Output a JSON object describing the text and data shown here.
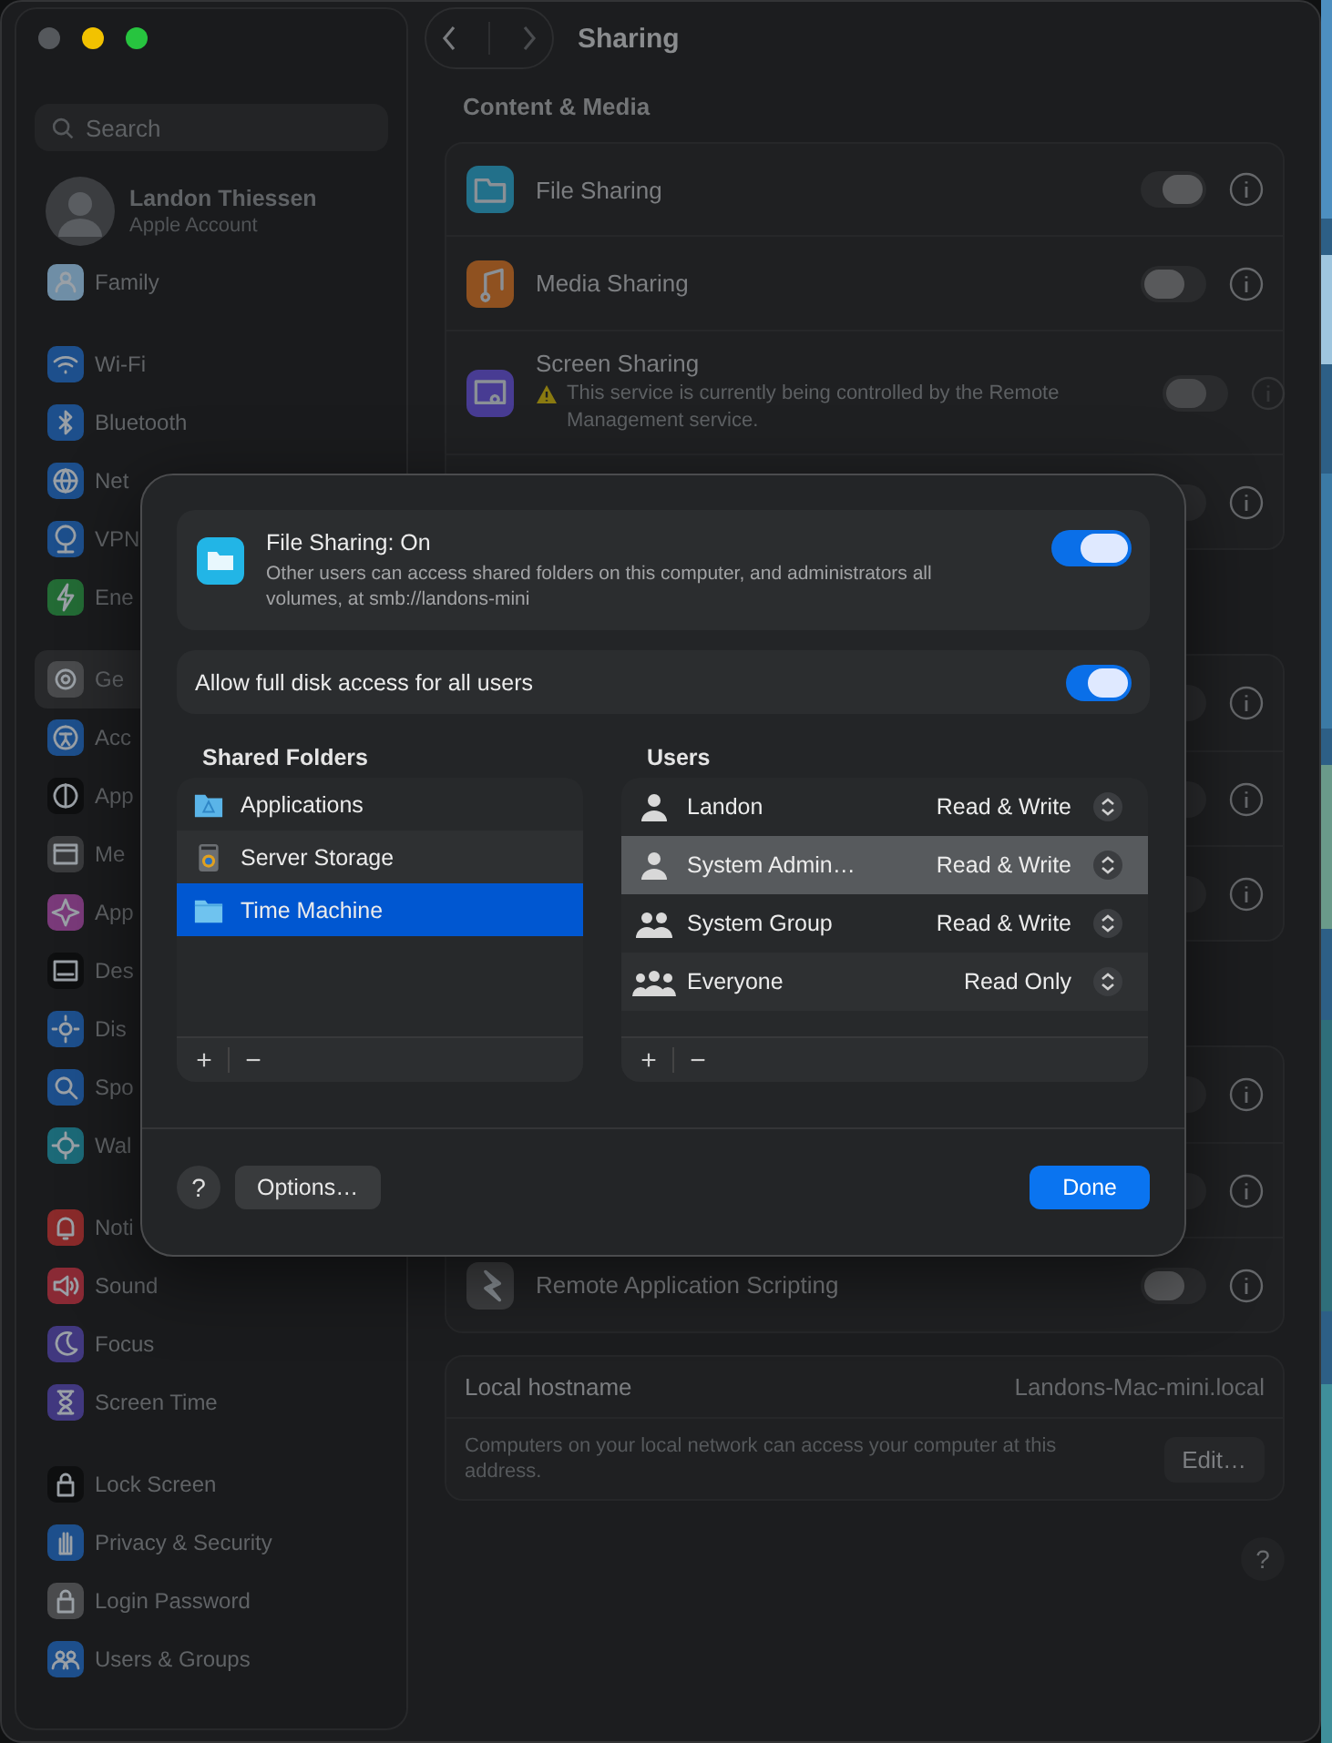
{
  "sidebar": {
    "search": {
      "placeholder": "Search"
    },
    "account": {
      "name": "Landon Thiessen",
      "subtitle": "Apple Account"
    },
    "groups": [
      [
        {
          "label": "Family",
          "kind": "family",
          "color": "#6f8ea6",
          "selected": false
        }
      ],
      [
        {
          "label": "Wi-Fi",
          "kind": "wifi",
          "color": "#1d4f8c",
          "selected": false
        },
        {
          "label": "Bluetooth",
          "kind": "bluetooth",
          "color": "#1d4f8c",
          "selected": false
        },
        {
          "label": "Net",
          "kind": "globe",
          "color": "#1d4f8c",
          "selected": false
        },
        {
          "label": "VPN",
          "kind": "globe-stand",
          "color": "#1d4f8c",
          "selected": false
        },
        {
          "label": "Ene",
          "kind": "bolt",
          "color": "#236b35",
          "selected": false
        }
      ],
      [
        {
          "label": "Ge",
          "kind": "gear",
          "color": "#4a4b4d",
          "selected": true
        },
        {
          "label": "Acc",
          "kind": "person-circle",
          "color": "#1d4f8c",
          "selected": false
        },
        {
          "label": "App",
          "kind": "half-circle",
          "color": "#0e0f10",
          "selected": false
        },
        {
          "label": "Me",
          "kind": "window",
          "color": "#3a3b3d",
          "selected": false
        },
        {
          "label": "App",
          "kind": "sparkle",
          "color": "#7a3a7a",
          "selected": false
        },
        {
          "label": "Des",
          "kind": "dock",
          "color": "#0e0f10",
          "selected": false
        },
        {
          "label": "Dis",
          "kind": "sun",
          "color": "#1d4f8c",
          "selected": false
        },
        {
          "label": "Spo",
          "kind": "magnifier",
          "color": "#1d4f8c",
          "selected": false
        },
        {
          "label": "Wal",
          "kind": "flower",
          "color": "#1c6a78",
          "selected": false
        }
      ],
      [
        {
          "label": "Noti",
          "kind": "bell",
          "color": "#8a2a2a",
          "selected": false
        },
        {
          "label": "Sound",
          "kind": "speaker",
          "color": "#8a2a35",
          "selected": false
        },
        {
          "label": "Focus",
          "kind": "moon",
          "color": "#41387f",
          "selected": false
        },
        {
          "label": "Screen Time",
          "kind": "hourglass",
          "color": "#41387f",
          "selected": false
        }
      ],
      [
        {
          "label": "Lock Screen",
          "kind": "lock",
          "color": "#0e0f10",
          "selected": false
        },
        {
          "label": "Privacy & Security",
          "kind": "hand",
          "color": "#1d4f8c",
          "selected": false
        },
        {
          "label": "Login Password",
          "kind": "lock",
          "color": "#4a4b4d",
          "selected": false
        },
        {
          "label": "Users & Groups",
          "kind": "people",
          "color": "#1d4f8c",
          "selected": false
        }
      ]
    ]
  },
  "header": {
    "title": "Sharing"
  },
  "sections": [
    {
      "title": "Content & Media",
      "rows": [
        {
          "label": "File Sharing",
          "kind": "folder",
          "color": "#22708a",
          "on": true,
          "disabled": false
        },
        {
          "label": "Media Sharing",
          "kind": "music",
          "color": "#8f5120",
          "on": false,
          "disabled": false
        },
        {
          "label": "Screen Sharing",
          "kind": "screen",
          "color": "#483c93",
          "on": false,
          "disabled": true,
          "warning": "This service is currently being controlled by the Remote Management service."
        },
        {
          "on": false,
          "disabled": false
        }
      ]
    },
    {
      "rows": [
        {
          "on": false,
          "disabled": false
        },
        {
          "on": false,
          "disabled": false
        },
        {
          "on": false,
          "disabled": false
        }
      ]
    },
    {
      "rows": [
        {
          "on": false,
          "disabled": false
        },
        {
          "on": false,
          "disabled": false
        },
        {
          "label": "Remote Application Scripting",
          "kind": "feather",
          "color": "#3e3f41",
          "on": false,
          "disabled": false
        }
      ]
    }
  ],
  "hostname": {
    "label": "Local hostname",
    "value": "Landons-Mac-mini.local",
    "note": "Computers on your local network can access your computer at this address.",
    "button": "Edit…"
  },
  "help": "?",
  "dialog": {
    "service": {
      "title": "File Sharing: On",
      "description": "Other users can access shared folders on this computer, and administrators all volumes, at smb://landons-mini",
      "on": true
    },
    "full_disk": {
      "label": "Allow full disk access for all users",
      "on": true
    },
    "folders": {
      "heading": "Shared Folders",
      "add": "+",
      "remove": "−",
      "items": [
        {
          "name": "Applications",
          "kind": "apps-folder",
          "selected": false
        },
        {
          "name": "Server Storage",
          "kind": "drive",
          "selected": false
        },
        {
          "name": "Time Machine",
          "kind": "folder",
          "selected": true
        }
      ]
    },
    "users": {
      "heading": "Users",
      "add": "+",
      "remove": "−",
      "items": [
        {
          "name": "Landon",
          "kind": "user",
          "permission": "Read & Write",
          "selected": false
        },
        {
          "name": "System Admin…",
          "kind": "user",
          "permission": "Read & Write",
          "selected": true
        },
        {
          "name": "System Group",
          "kind": "group",
          "permission": "Read & Write",
          "selected": false
        },
        {
          "name": "Everyone",
          "kind": "everyone",
          "permission": "Read Only",
          "selected": false
        }
      ]
    },
    "help": "?",
    "options": "Options…",
    "done": "Done"
  }
}
